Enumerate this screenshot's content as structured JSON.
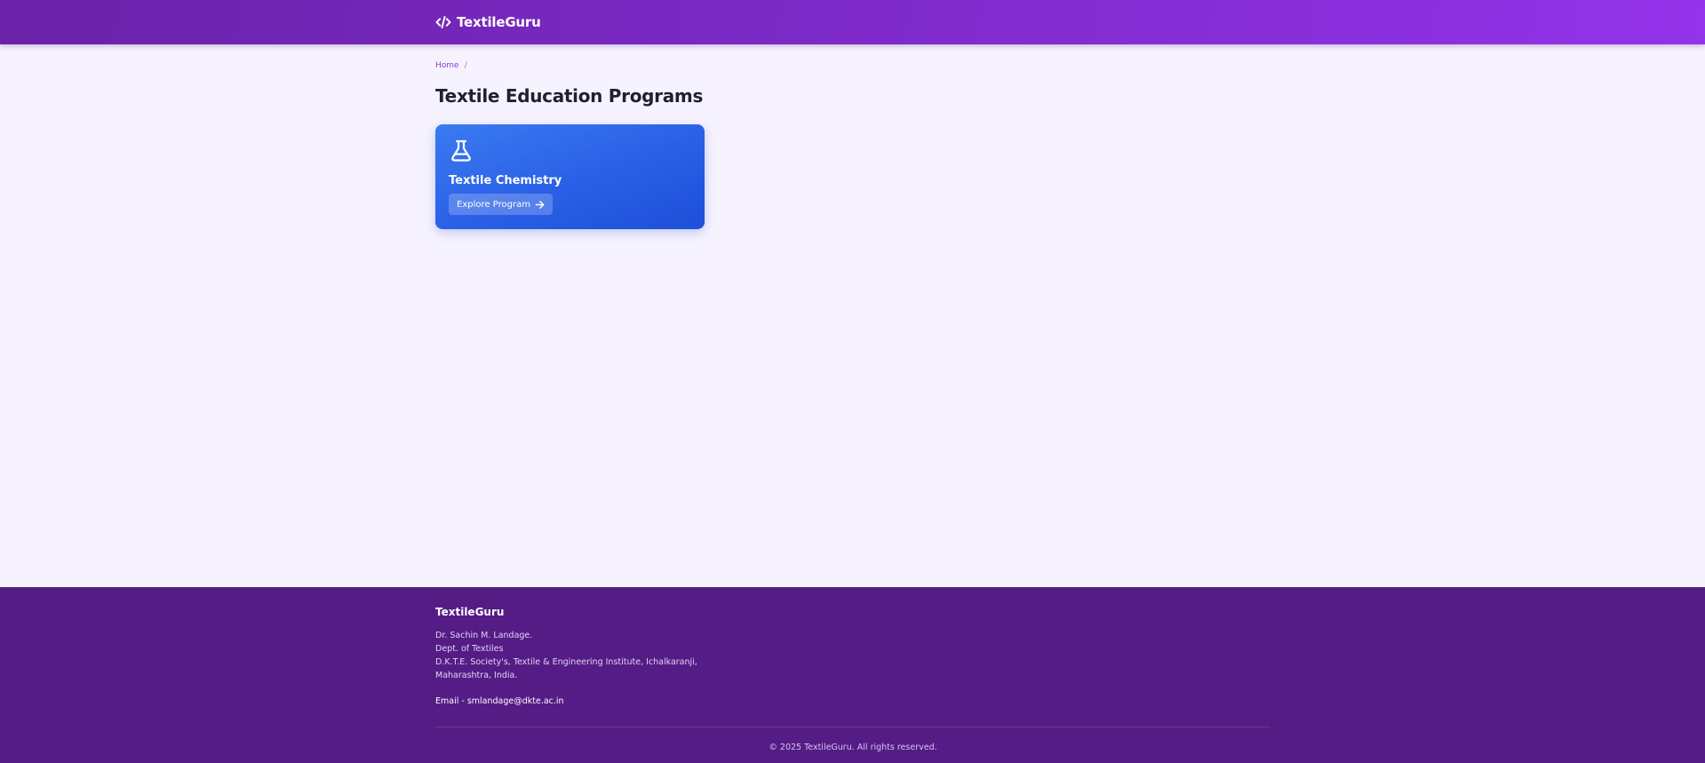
{
  "header": {
    "brand": "TextileGuru",
    "brand_icon": "code-icon"
  },
  "breadcrumb": {
    "items": [
      "Home"
    ],
    "separator": "/"
  },
  "main": {
    "title": "Textile Education Programs",
    "programs": [
      {
        "icon": "flask-icon",
        "title": "Textile Chemistry",
        "button_label": "Explore Program",
        "button_icon": "arrow-right-icon"
      }
    ]
  },
  "footer": {
    "brand": "TextileGuru",
    "address_lines": [
      "Dr. Sachin M. Landage.",
      "Dept. of Textiles",
      "D.K.T.E. Society's, Textile & Engineering Institute, Ichalkaranji,",
      "Maharashtra, India."
    ],
    "email": "Email - smlandage@dkte.ac.in",
    "copyright": "© 2025 TextileGuru. All rights reserved."
  },
  "colors": {
    "header_gradient_start": "#6a22a8",
    "header_gradient_end": "#9333ea",
    "page_background": "#f7f3fe",
    "card_gradient_start": "#3a7bf2",
    "card_gradient_end": "#1d4fd8",
    "footer_background": "#551c86",
    "accent": "#8a3bde"
  }
}
